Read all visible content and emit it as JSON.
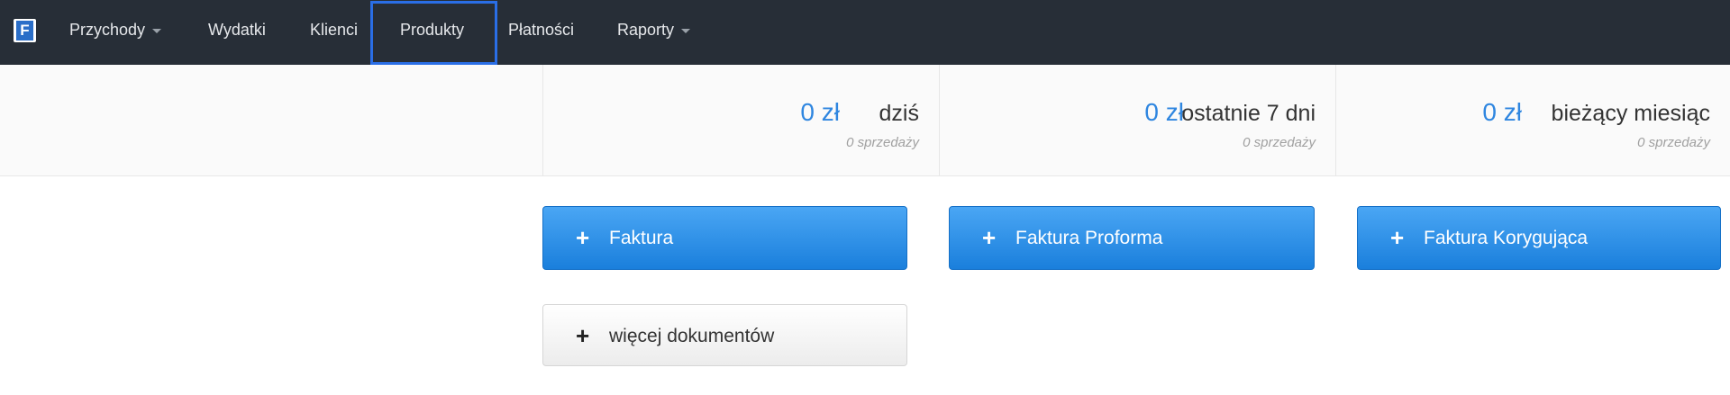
{
  "app": {
    "logo_letter": "F"
  },
  "nav": {
    "items": [
      {
        "label": "Przychody",
        "dropdown": true
      },
      {
        "label": "Wydatki",
        "dropdown": false
      },
      {
        "label": "Klienci",
        "dropdown": false
      },
      {
        "label": "Produkty",
        "dropdown": false,
        "active": true
      },
      {
        "label": "Płatności",
        "dropdown": false
      },
      {
        "label": "Raporty",
        "dropdown": true
      }
    ]
  },
  "stats": [
    {
      "amount": "0 zł",
      "period": "dziś",
      "sales": "0 sprzedaży"
    },
    {
      "amount": "0 zł",
      "period": "ostatnie 7 dni",
      "sales": "0 sprzedaży"
    },
    {
      "amount": "0 zł",
      "period": "bieżący miesiąc",
      "sales": "0 sprzedaży"
    }
  ],
  "actions": {
    "plus_symbol": "+",
    "primary": [
      {
        "label": "Faktura"
      },
      {
        "label": "Faktura Proforma"
      },
      {
        "label": "Faktura Korygująca"
      }
    ],
    "more_label": "więcej dokumentów"
  },
  "colors": {
    "navbar_bg": "#272e37",
    "accent_blue": "#2f86e0",
    "highlight_blue": "#2a6ee6",
    "button_blue": "#1a7fdc"
  }
}
